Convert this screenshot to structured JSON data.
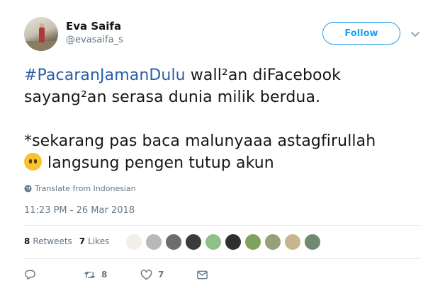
{
  "author": {
    "display_name": "Eva Saifa",
    "handle": "@evasaifa_s"
  },
  "follow_label": "Follow",
  "tweet": {
    "hashtag": "#PacaranJamanDulu",
    "line1_rest": " wall²an diFacebook",
    "line2": "sayang²an serasa dunia milik berdua.",
    "line3": "*sekarang pas baca malunyaaa astagfirullah",
    "line4": "langsung pengen tutup akun"
  },
  "translate_label": "Translate from Indonesian",
  "timestamp": "11:23 PM - 26 Mar 2018",
  "stats": {
    "retweets_count": "8",
    "retweets_label": "Retweets",
    "likes_count": "7",
    "likes_label": "Likes"
  },
  "liker_colors": [
    "#f2efe9",
    "#b8b8b8",
    "#6d6d6d",
    "#3b3b3b",
    "#8fc08a",
    "#2f2f2f",
    "#7fa35b",
    "#97a07a",
    "#c7b58f",
    "#6f8a70"
  ],
  "actions": {
    "reply_count": "",
    "retweet_count": "8",
    "like_count": "7"
  },
  "colors": {
    "link": "#1da1f2",
    "hashtag": "#2b5ea8",
    "muted": "#657786"
  }
}
